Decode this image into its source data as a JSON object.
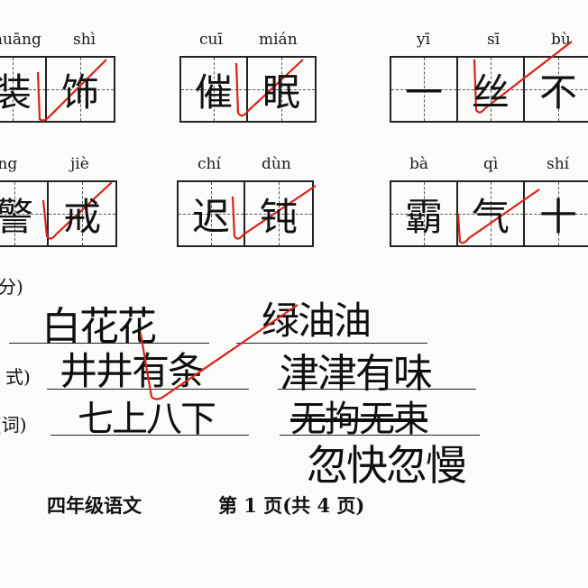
{
  "pinyin_row1": [
    "huāng",
    "shì",
    "cuī",
    "mián",
    "yī",
    "sī",
    "bù"
  ],
  "pinyin_row2": [
    "ǐng",
    "jiè",
    "chí",
    "dùn",
    "bà",
    "qì",
    "shí"
  ],
  "grid_row1": [
    "装",
    "饰",
    "催",
    "眠",
    "一",
    "丝",
    "不"
  ],
  "grid_row2": [
    "警",
    "戒",
    "迟",
    "钝",
    "霸",
    "气",
    "十"
  ],
  "section_labels": [
    "分)",
    "式)",
    "(词)"
  ],
  "handwritten": {
    "word1": "白花花",
    "word2": "绿油油",
    "word3": "井井有条",
    "word4": "津津有味",
    "word5": "七上八下",
    "word6": "无拘无束",
    "word7": "忽快忽慢"
  },
  "footer": {
    "grade_subject": "四年级语文",
    "page_info": "第 1 页(共 4 页)"
  },
  "colors": {
    "ink": "#111111",
    "check_mark": "#d8231a",
    "paper": "#fbfbf9"
  }
}
